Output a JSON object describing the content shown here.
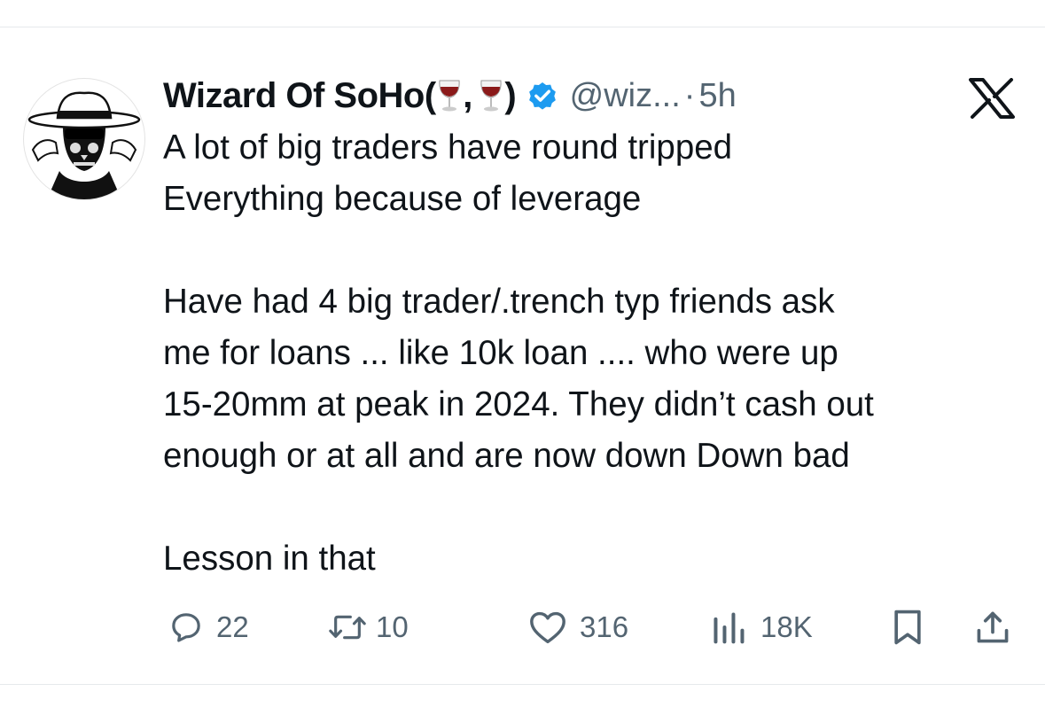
{
  "tweet": {
    "author_name": "Wizard Of SoHo",
    "name_open": " (",
    "name_sep": ",",
    "name_close": ")",
    "handle": "@wiz...",
    "separator": "·",
    "time": "5h",
    "lines": [
      "A lot of big traders have round tripped",
      "Everything because of leverage",
      "",
      "Have had 4 big trader/.trench typ friends ask",
      "me for loans ... like 10k loan .... who were up",
      "15-20mm at peak in 2024. They didn’t cash out",
      "enough or at all and are now down Down bad",
      "",
      "Lesson in that"
    ]
  },
  "actions": {
    "replies": "22",
    "reposts": "10",
    "likes": "316",
    "views": "18K"
  },
  "icons": [
    "avatar",
    "wine-glass-icon",
    "verified-badge-icon",
    "x-logo-icon",
    "reply-icon",
    "repost-icon",
    "like-icon",
    "views-icon",
    "bookmark-icon",
    "share-icon"
  ],
  "colors": {
    "text": "#0f1419",
    "muted": "#536471",
    "verified": "#1d9bf0",
    "wine": "#8b1a1a"
  }
}
